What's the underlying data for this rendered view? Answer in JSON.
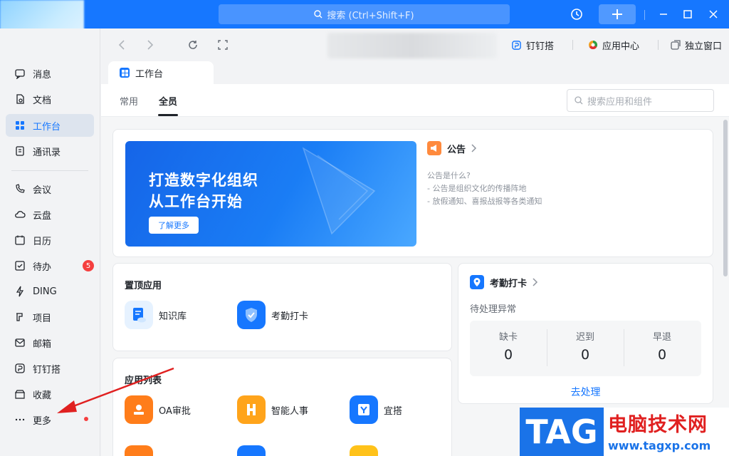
{
  "titlebar": {
    "search_placeholder": "搜索 (Ctrl+Shift+F)"
  },
  "sidebar": {
    "items": [
      {
        "label": "消息",
        "icon": "message-icon"
      },
      {
        "label": "文档",
        "icon": "document-icon"
      },
      {
        "label": "工作台",
        "icon": "workbench-icon",
        "active": true
      },
      {
        "label": "通讯录",
        "icon": "contacts-icon"
      },
      {
        "label": "会议",
        "icon": "phone-icon"
      },
      {
        "label": "云盘",
        "icon": "cloud-icon"
      },
      {
        "label": "日历",
        "icon": "calendar-icon"
      },
      {
        "label": "待办",
        "icon": "todo-icon",
        "badge": "5"
      },
      {
        "label": "DING",
        "icon": "lightning-icon"
      },
      {
        "label": "项目",
        "icon": "project-icon"
      },
      {
        "label": "邮箱",
        "icon": "mail-icon"
      },
      {
        "label": "钉钉搭",
        "icon": "dingda-icon"
      },
      {
        "label": "收藏",
        "icon": "favorites-icon"
      },
      {
        "label": "更多",
        "icon": "more-icon"
      }
    ]
  },
  "nav": {
    "dingda": "钉钉搭",
    "app_center": "应用中心",
    "standalone": "独立窗口"
  },
  "tab": {
    "label": "工作台"
  },
  "subtabs": {
    "common": "常用",
    "all": "全员",
    "search_placeholder": "搜索应用和组件"
  },
  "banner": {
    "line1": "打造数字化组织",
    "line2": "从工作台开始",
    "button": "了解更多"
  },
  "notice": {
    "title": "公告",
    "lines": [
      "公告是什么?",
      "- 公告是组织文化的传播阵地",
      "- 放假通知、喜报战报等各类通知"
    ]
  },
  "pinned": {
    "title": "置顶应用",
    "apps": [
      "知识库",
      "考勤打卡"
    ]
  },
  "attendance": {
    "title": "考勤打卡",
    "subtitle": "待处理异常",
    "stats": [
      {
        "label": "缺卡",
        "value": "0"
      },
      {
        "label": "迟到",
        "value": "0"
      },
      {
        "label": "早退",
        "value": "0"
      }
    ],
    "action": "去处理"
  },
  "applist": {
    "title": "应用列表",
    "apps": [
      "OA审批",
      "智能人事",
      "宜搭"
    ]
  },
  "watermark": {
    "tag": "TAG",
    "name": "电脑技术网",
    "url": "www.tagxp.com"
  },
  "colors": {
    "accent": "#1677ff",
    "badge": "#f53f3f"
  }
}
